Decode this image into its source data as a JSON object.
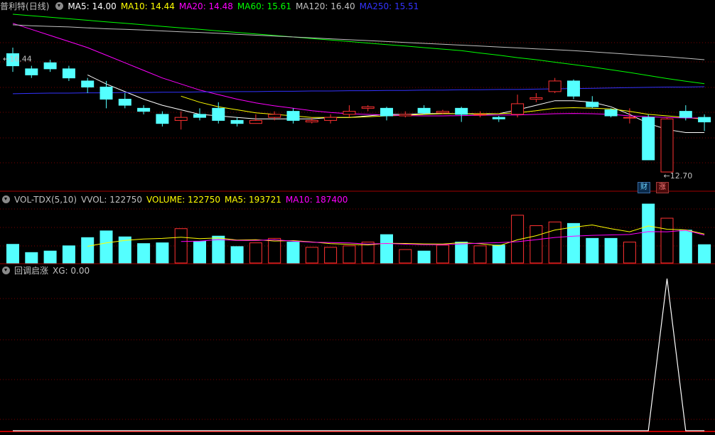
{
  "price_panel": {
    "stock_name": "普利特",
    "period": "(日线)",
    "ma_labels": [
      {
        "text": "MA5: 14.00",
        "color": "#ffffff"
      },
      {
        "text": "MA10: 14.44",
        "color": "#ffff00"
      },
      {
        "text": "MA20: 14.48",
        "color": "#ff00ff"
      },
      {
        "text": "MA60: 15.61",
        "color": "#00ff00"
      },
      {
        "text": "MA120: 16.40",
        "color": "#c0c0c0"
      },
      {
        "text": "MA250: 15.51",
        "color": "#3333ff"
      }
    ],
    "high_label": "16.44",
    "low_label": "12.70",
    "tag_cai": "财",
    "tag_zhang": "涨"
  },
  "volume_panel": {
    "indicator": "VOL-TDX(5,10)",
    "labels": [
      {
        "text": "VVOL: 122750",
        "color": "#c0c0c0"
      },
      {
        "text": "VOLUME: 122750",
        "color": "#ffff00"
      },
      {
        "text": "MA5: 193721",
        "color": "#ffff00"
      },
      {
        "text": "MA10: 187400",
        "color": "#ff00ff"
      }
    ]
  },
  "signal_panel": {
    "indicator": "回调启涨",
    "labels": [
      {
        "text": "XG: 0.00",
        "color": "#c0c0c0"
      }
    ]
  },
  "chart_data": {
    "type": "candlestick",
    "candles": [
      [
        16.6,
        16.2,
        16.8,
        16.0
      ],
      [
        16.1,
        15.9,
        16.2,
        15.8
      ],
      [
        16.3,
        16.1,
        16.4,
        16.0
      ],
      [
        16.1,
        15.8,
        16.2,
        15.7
      ],
      [
        15.7,
        15.5,
        15.8,
        15.3
      ],
      [
        15.5,
        15.1,
        15.7,
        14.8
      ],
      [
        15.1,
        14.9,
        15.3,
        14.8
      ],
      [
        14.8,
        14.7,
        14.9,
        14.6
      ],
      [
        14.6,
        14.3,
        14.7,
        14.2
      ],
      [
        14.4,
        14.5,
        14.7,
        14.1
      ],
      [
        14.6,
        14.5,
        14.8,
        14.4
      ],
      [
        14.8,
        14.4,
        15.0,
        14.3
      ],
      [
        14.4,
        14.3,
        14.5,
        14.2
      ],
      [
        14.3,
        14.4,
        14.6,
        14.3
      ],
      [
        14.5,
        14.6,
        14.7,
        14.4
      ],
      [
        14.7,
        14.4,
        14.8,
        14.3
      ],
      [
        14.35,
        14.4,
        14.5,
        14.3
      ],
      [
        14.4,
        14.5,
        14.6,
        14.3
      ],
      [
        14.6,
        14.7,
        14.9,
        14.5
      ],
      [
        14.8,
        14.85,
        14.9,
        14.7
      ],
      [
        14.8,
        14.55,
        14.85,
        14.4
      ],
      [
        14.55,
        14.6,
        14.7,
        14.5
      ],
      [
        14.8,
        14.65,
        14.9,
        14.6
      ],
      [
        14.65,
        14.7,
        14.75,
        14.6
      ],
      [
        14.8,
        14.6,
        14.85,
        14.35
      ],
      [
        14.6,
        14.6,
        14.7,
        14.5
      ],
      [
        14.5,
        14.45,
        14.55,
        14.35
      ],
      [
        14.6,
        14.95,
        15.25,
        14.5
      ],
      [
        15.1,
        15.15,
        15.3,
        15.0
      ],
      [
        15.35,
        15.7,
        15.8,
        15.3
      ],
      [
        15.7,
        15.2,
        15.75,
        15.1
      ],
      [
        15.0,
        14.85,
        15.2,
        14.8
      ],
      [
        14.75,
        14.55,
        14.8,
        14.5
      ],
      [
        14.5,
        14.5,
        14.8,
        14.3
      ],
      [
        14.5,
        13.1,
        14.6,
        13.1
      ],
      [
        12.7,
        14.45,
        14.5,
        12.7
      ],
      [
        14.7,
        14.5,
        14.9,
        14.4
      ],
      [
        14.5,
        14.35,
        14.6,
        14.05
      ]
    ],
    "series": [
      {
        "name": "MA5",
        "values": [
          null,
          null,
          null,
          null,
          15.9,
          15.6,
          15.35,
          15.1,
          14.9,
          14.75,
          14.6,
          14.55,
          14.5,
          14.45,
          14.45,
          14.45,
          14.45,
          14.5,
          14.5,
          14.55,
          14.6,
          14.6,
          14.62,
          14.63,
          14.62,
          14.6,
          14.62,
          14.75,
          14.9,
          15.05,
          15.05,
          15.0,
          14.85,
          14.6,
          14.3,
          14.1,
          14.0,
          14.0
        ]
      },
      {
        "name": "MA10",
        "values": [
          null,
          null,
          null,
          null,
          null,
          null,
          null,
          null,
          null,
          15.2,
          15.0,
          14.85,
          14.75,
          14.65,
          14.6,
          14.55,
          14.5,
          14.5,
          14.5,
          14.52,
          14.55,
          14.57,
          14.6,
          14.62,
          14.62,
          14.62,
          14.62,
          14.65,
          14.72,
          14.8,
          14.82,
          14.8,
          14.78,
          14.7,
          14.6,
          14.55,
          14.5,
          14.44
        ]
      },
      {
        "name": "MA20",
        "values": [
          17.6,
          17.4,
          17.2,
          17.0,
          16.8,
          16.55,
          16.3,
          16.05,
          15.8,
          15.6,
          15.4,
          15.25,
          15.1,
          14.98,
          14.88,
          14.8,
          14.72,
          14.66,
          14.62,
          14.6,
          14.58,
          14.56,
          14.55,
          14.55,
          14.56,
          14.57,
          14.58,
          14.58,
          14.6,
          14.62,
          14.63,
          14.62,
          14.6,
          14.55,
          14.52,
          14.5,
          14.48,
          14.48
        ]
      },
      {
        "name": "MA60",
        "values": [
          17.9,
          17.85,
          17.8,
          17.75,
          17.7,
          17.65,
          17.6,
          17.55,
          17.5,
          17.45,
          17.4,
          17.35,
          17.3,
          17.25,
          17.2,
          17.15,
          17.1,
          17.05,
          17.0,
          16.95,
          16.9,
          16.85,
          16.8,
          16.75,
          16.7,
          16.62,
          16.55,
          16.47,
          16.4,
          16.32,
          16.24,
          16.16,
          16.07,
          15.98,
          15.88,
          15.78,
          15.69,
          15.61
        ]
      },
      {
        "name": "MA120",
        "values": [
          17.55,
          17.52,
          17.5,
          17.48,
          17.45,
          17.42,
          17.4,
          17.38,
          17.35,
          17.32,
          17.3,
          17.27,
          17.24,
          17.21,
          17.18,
          17.15,
          17.12,
          17.09,
          17.06,
          17.03,
          17.0,
          16.97,
          16.94,
          16.91,
          16.88,
          16.85,
          16.82,
          16.79,
          16.76,
          16.73,
          16.7,
          16.66,
          16.62,
          16.58,
          16.54,
          16.5,
          16.45,
          16.4
        ]
      },
      {
        "name": "MA250",
        "values": [
          15.28,
          15.29,
          15.3,
          15.3,
          15.31,
          15.31,
          15.32,
          15.32,
          15.33,
          15.33,
          15.34,
          15.34,
          15.35,
          15.35,
          15.36,
          15.36,
          15.37,
          15.37,
          15.38,
          15.38,
          15.39,
          15.39,
          15.4,
          15.4,
          15.41,
          15.41,
          15.42,
          15.42,
          15.43,
          15.44,
          15.45,
          15.46,
          15.47,
          15.48,
          15.49,
          15.5,
          15.5,
          15.51
        ]
      }
    ],
    "volume": [
      125000,
      70000,
      80000,
      115000,
      170000,
      215000,
      175000,
      130000,
      135000,
      230000,
      145000,
      180000,
      110000,
      135000,
      165000,
      140000,
      105000,
      105000,
      115000,
      140000,
      190000,
      90000,
      80000,
      120000,
      140000,
      115000,
      120000,
      320000,
      250000,
      275000,
      265000,
      165000,
      165000,
      140000,
      395000,
      300000,
      220000,
      122750
    ],
    "volume_ma5": [
      null,
      null,
      null,
      null,
      112000,
      135000,
      151000,
      161000,
      165000,
      173000,
      163000,
      168000,
      154000,
      156000,
      147000,
      150000,
      141000,
      130000,
      125000,
      121000,
      132000,
      131000,
      128000,
      127000,
      136000,
      129000,
      115000,
      155000,
      183000,
      221000,
      240000,
      255000,
      230000,
      209000,
      248000,
      226000,
      222000,
      193721
    ],
    "volume_ma10": [
      null,
      null,
      null,
      null,
      null,
      null,
      null,
      null,
      null,
      144500,
      146000,
      157000,
      151000,
      151000,
      155000,
      146000,
      139000,
      137000,
      135000,
      126500,
      131000,
      126000,
      123000,
      123000,
      128000,
      133000,
      136000,
      143000,
      156000,
      171000,
      180000,
      185000,
      188000,
      191000,
      210000,
      209000,
      219000,
      187400
    ],
    "xg": [
      0,
      0,
      0,
      0,
      0,
      0,
      0,
      0,
      0,
      0,
      0,
      0,
      0,
      0,
      0,
      0,
      0,
      0,
      0,
      0,
      0,
      0,
      0,
      0,
      0,
      0,
      0,
      0,
      0,
      0,
      0,
      0,
      0,
      0,
      0,
      1,
      0,
      0
    ],
    "price_range": [
      12.7,
      17.9
    ]
  }
}
